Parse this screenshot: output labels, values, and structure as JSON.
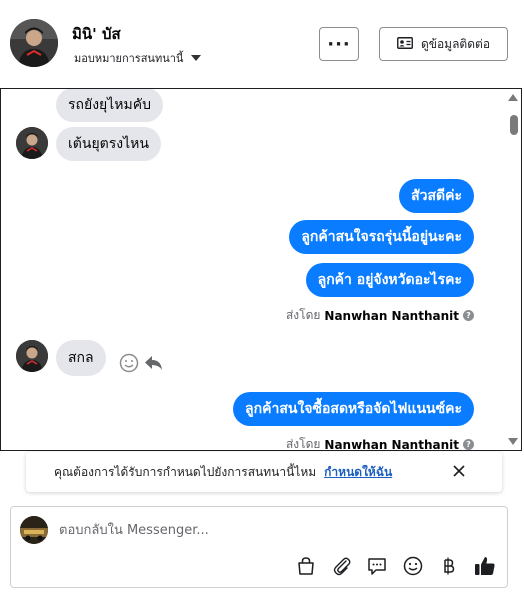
{
  "header": {
    "contact_name": "มินิ' บัส",
    "assign_label": "มอบหมายการสนทนานี้",
    "more_label": "···",
    "contact_info_label": "ดูข้อมูลติดต่อ"
  },
  "messages": [
    {
      "text": "รถยังยุไหมคับ",
      "dir": "in"
    },
    {
      "text": "เต้นยุตรงไหน",
      "dir": "in"
    },
    {
      "text": "สัวสดีค่ะ",
      "dir": "out"
    },
    {
      "text": "ลูกค้าสนใจรถรุ่นนี้อยู่นะคะ",
      "dir": "out"
    },
    {
      "text": "ลูกค้า  อยู่จังหวัดอะไรคะ",
      "dir": "out"
    },
    {
      "text": "สกล",
      "dir": "in"
    },
    {
      "text": "ลูกค้าสนใจซื้อสดหรือจัดไฟแนนซ์คะ",
      "dir": "out"
    }
  ],
  "sent_by": {
    "prefix": "ส่งโดย",
    "name": "Nanwhan Nanthanit",
    "info": "?"
  },
  "banner": {
    "text": "คุณต้องการได้รับการกำหนดไปยังการสนทนานี้ไหม",
    "link": "กำหนดให้ฉัน"
  },
  "composer": {
    "placeholder": "ตอบกลับใน Messenger...",
    "tools": [
      "shopping-bag-icon",
      "paperclip-icon",
      "saved-reply-icon",
      "emoji-icon",
      "baht-icon",
      "thumbs-up-icon"
    ]
  },
  "colors": {
    "outgoing_bubble": "#0a7cff",
    "incoming_bubble": "#e4e6eb",
    "link": "#1c5fbf"
  }
}
